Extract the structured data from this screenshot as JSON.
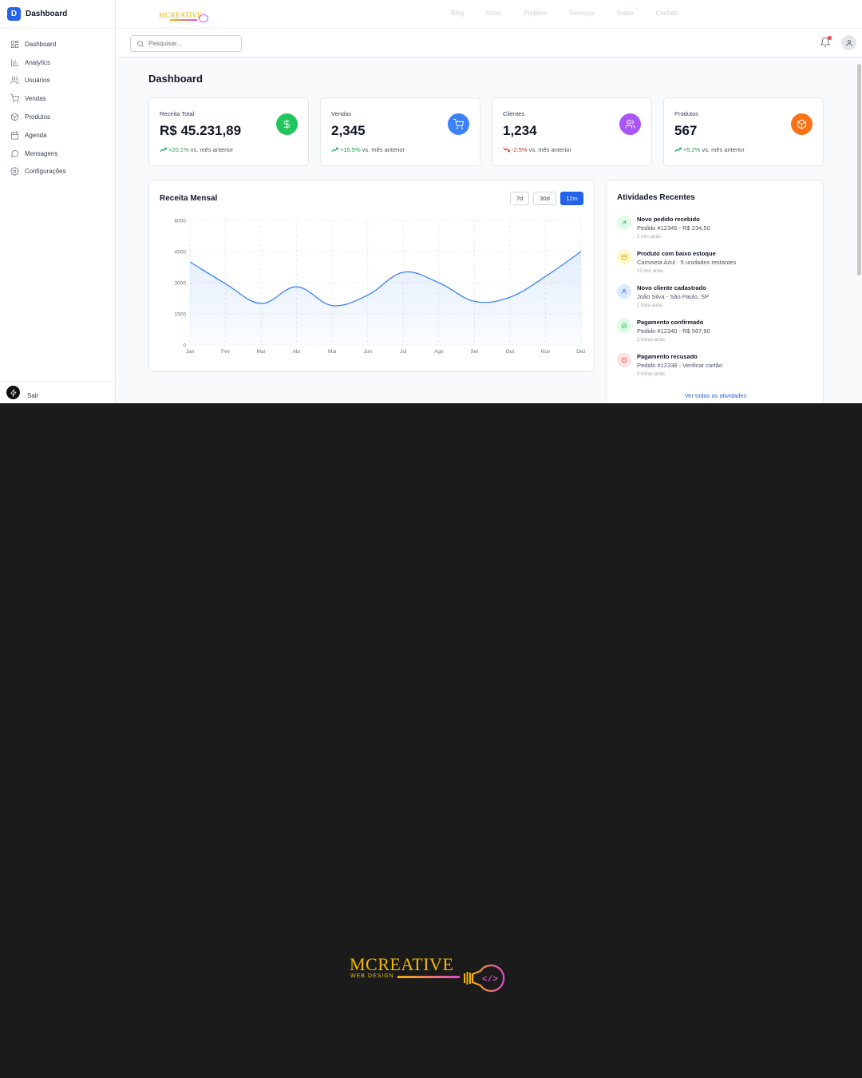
{
  "colors": {
    "primary": "#2563eb",
    "green": "#22c55e",
    "blue": "#3b82f6",
    "purple": "#a855f7",
    "orange": "#f97316",
    "red": "#ef4444",
    "brand_gold": "#f2b807",
    "brand_pink": "#e048c8"
  },
  "sidebar": {
    "logo_letter": "D",
    "title": "Dashboard",
    "items": [
      {
        "label": "Dashboard",
        "icon": "grid-icon"
      },
      {
        "label": "Analytics",
        "icon": "bar-chart-icon"
      },
      {
        "label": "Usuários",
        "icon": "users-icon"
      },
      {
        "label": "Vendas",
        "icon": "cart-icon"
      },
      {
        "label": "Produtos",
        "icon": "box-icon"
      },
      {
        "label": "Agenda",
        "icon": "calendar-icon"
      },
      {
        "label": "Mensagens",
        "icon": "message-icon"
      },
      {
        "label": "Configurações",
        "icon": "settings-icon"
      }
    ],
    "logout_label": "Sair"
  },
  "topbar": {
    "logo_text": "MCREATIVE",
    "nav": [
      "Blog",
      "Início",
      "Projetos",
      "Serviços",
      "Sobre",
      "Contato"
    ]
  },
  "header": {
    "search_placeholder": "Pesquisar..."
  },
  "page": {
    "title": "Dashboard"
  },
  "stats": [
    {
      "label": "Receita Total",
      "value": "R$ 45.231,89",
      "change": "+20.1%",
      "direction": "up",
      "suffix": "vs. mês anterior",
      "icon": "dollar-icon",
      "color": "#22c55e"
    },
    {
      "label": "Vendas",
      "value": "2,345",
      "change": "+15.5%",
      "direction": "up",
      "suffix": "vs. mês anterior",
      "icon": "cart-icon",
      "color": "#3b82f6"
    },
    {
      "label": "Clientes",
      "value": "1,234",
      "change": "-2.5%",
      "direction": "down",
      "suffix": "vs. mês anterior",
      "icon": "users-icon",
      "color": "#a855f7"
    },
    {
      "label": "Produtos",
      "value": "567",
      "change": "+5.2%",
      "direction": "up",
      "suffix": "vs. mês anterior",
      "icon": "box-icon",
      "color": "#f97316"
    }
  ],
  "chart": {
    "title": "Receita Mensal",
    "ranges": [
      {
        "label": "7d",
        "active": false
      },
      {
        "label": "30d",
        "active": false
      },
      {
        "label": "12m",
        "active": true
      }
    ]
  },
  "chart_data": {
    "type": "area",
    "title": "Receita Mensal",
    "xlabel": "",
    "ylabel": "",
    "categories": [
      "Jan",
      "Fev",
      "Mar",
      "Abr",
      "Mai",
      "Jun",
      "Jul",
      "Ago",
      "Set",
      "Out",
      "Nov",
      "Dez"
    ],
    "values": [
      4000,
      2950,
      2000,
      2800,
      1900,
      2400,
      3500,
      3000,
      2100,
      2300,
      3300,
      4500
    ],
    "yticks": [
      0,
      1500,
      3000,
      4500,
      6000
    ],
    "ylim": [
      0,
      6000
    ],
    "grid": true,
    "color": "#3b82f6"
  },
  "activity": {
    "title": "Atividades Recentes",
    "items": [
      {
        "title": "Novo pedido recebido",
        "desc": "Pedido #12345 - R$ 234,50",
        "time": "2 min atrás",
        "icon": "arrow-up-right-icon",
        "bg": "#dcfce7",
        "fg": "#16a34a"
      },
      {
        "title": "Produto com baixo estoque",
        "desc": "Camiseta Azul - 5 unidades restantes",
        "time": "15 min atrás",
        "icon": "box-icon",
        "bg": "#fef9c3",
        "fg": "#ca8a04"
      },
      {
        "title": "Novo cliente cadastrado",
        "desc": "João Silva - São Paulo, SP",
        "time": "1 hora atrás",
        "icon": "user-icon",
        "bg": "#dbeafe",
        "fg": "#2563eb"
      },
      {
        "title": "Pagamento confirmado",
        "desc": "Pedido #12340 - R$ 567,90",
        "time": "2 horas atrás",
        "icon": "check-circle-icon",
        "bg": "#dcfce7",
        "fg": "#16a34a"
      },
      {
        "title": "Pagamento recusado",
        "desc": "Pedido #12338 - Verificar cartão",
        "time": "3 horas atrás",
        "icon": "alert-circle-icon",
        "bg": "#fee2e2",
        "fg": "#dc2626"
      }
    ],
    "link": "Ver todas as atividades"
  },
  "brand": {
    "name": "MCREATIVE",
    "tagline": "WEB DESIGN"
  }
}
